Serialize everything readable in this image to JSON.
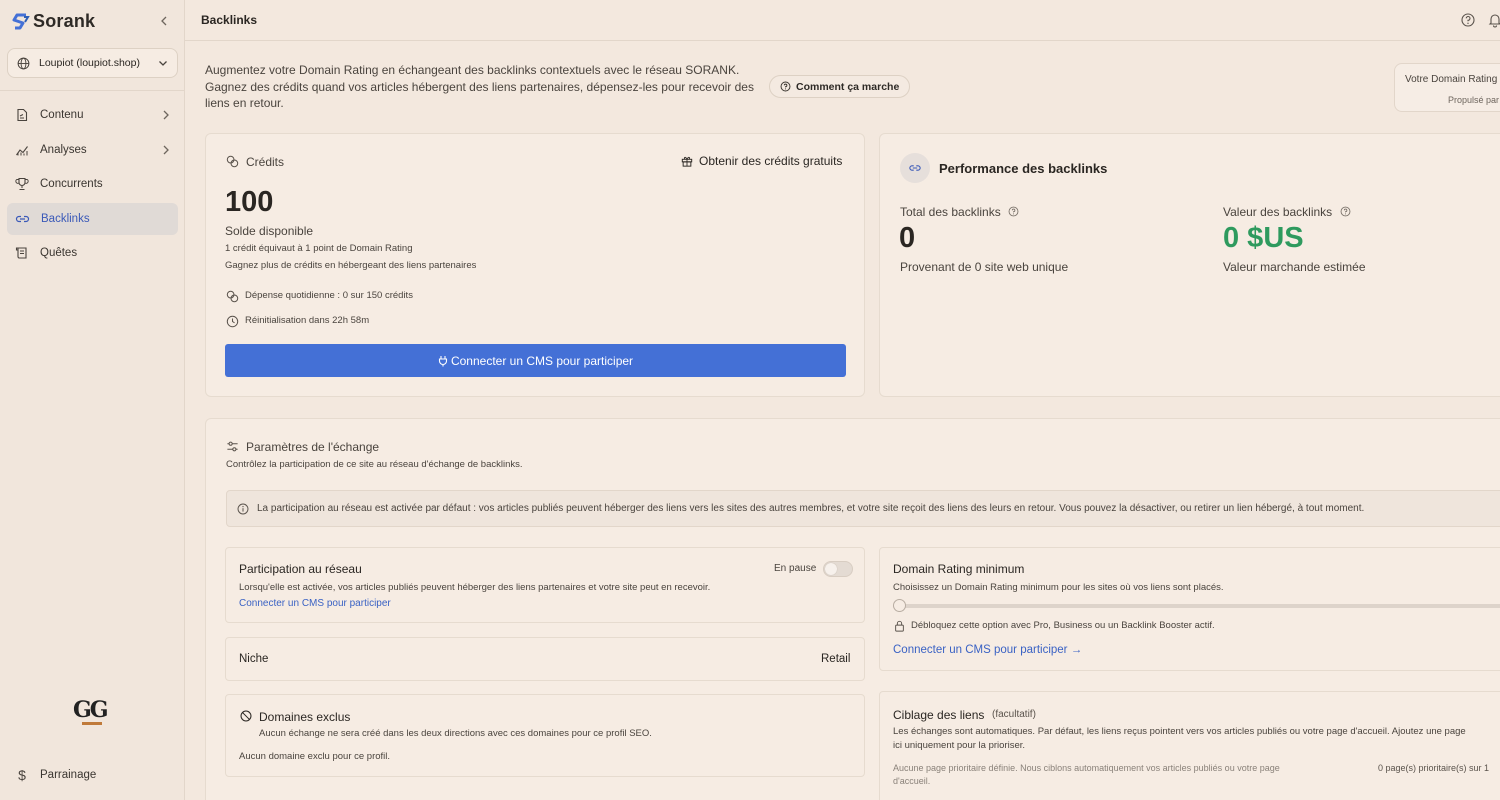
{
  "app": {
    "name": "Sorank"
  },
  "site_selector": {
    "label": "Loupiot (loupiot.shop)"
  },
  "nav": [
    {
      "label": "Contenu",
      "icon": "document-icon",
      "has_chevron": true
    },
    {
      "label": "Analyses",
      "icon": "chart-icon",
      "has_chevron": true
    },
    {
      "label": "Concurrents",
      "icon": "trophy-icon",
      "has_chevron": false
    },
    {
      "label": "Backlinks",
      "icon": "link-icon",
      "has_chevron": false,
      "active": true
    },
    {
      "label": "Quêtes",
      "icon": "scroll-icon",
      "has_chevron": false
    }
  ],
  "brand_logo": "GG",
  "referral": {
    "label": "Parrainage"
  },
  "header": {
    "title": "Backlinks"
  },
  "intro": {
    "text": "Augmentez votre Domain Rating en échangeant des backlinks contextuels avec le réseau SORANK. Gagnez des crédits quand vos articles hébergent des liens partenaires, dépensez-les pour recevoir des liens en retour.",
    "how_button": "Comment ça marche"
  },
  "dr_card": {
    "title": "Votre Domain Rating",
    "subtitle": "Propulsé par"
  },
  "credits": {
    "title": "Crédits",
    "free_credits_link": "Obtenir des crédits gratuits",
    "balance": "100",
    "balance_label": "Solde disponible",
    "note1": "1 crédit équivaut à 1 point de Domain Rating",
    "note2": "Gagnez plus de crédits en hébergeant des liens partenaires",
    "daily_spend": "Dépense quotidienne : 0 sur 150 crédits",
    "reset": "Réinitialisation dans 22h 58m",
    "cta": "Connecter un CMS pour participer"
  },
  "performance": {
    "title": "Performance des backlinks",
    "total_label": "Total des backlinks",
    "total_value": "0",
    "total_sub": "Provenant de 0 site web unique",
    "value_label": "Valeur des backlinks",
    "value_value": "0 $US",
    "value_sub": "Valeur marchande estimée"
  },
  "params": {
    "title": "Paramètres de l'échange",
    "subtitle": "Contrôlez la participation de ce site au réseau d'échange de backlinks.",
    "banner": "La participation au réseau est activée par défaut : vos articles publiés peuvent héberger des liens vers les sites des autres membres, et votre site reçoit des liens des leurs en retour. Vous pouvez la désactiver, ou retirer un lien hébergé, à tout moment.",
    "participation": {
      "title": "Participation au réseau",
      "status": "En pause",
      "desc": "Lorsqu'elle est activée, vos articles publiés peuvent héberger des liens partenaires et votre site peut en recevoir.",
      "link": "Connecter un CMS pour participer"
    },
    "niche": {
      "label": "Niche",
      "value": "Retail"
    },
    "excluded": {
      "title": "Domaines exclus",
      "desc": "Aucun échange ne sera créé dans les deux directions avec ces domaines pour ce profil SEO.",
      "empty": "Aucun domaine exclu pour ce profil."
    },
    "min_dr": {
      "title": "Domain Rating minimum",
      "desc": "Choisissez un Domain Rating minimum pour les sites où vos liens sont placés.",
      "slider_value": 0,
      "lock_note": "Débloquez cette option avec Pro, Business ou un Backlink Booster actif.",
      "link": "Connecter un CMS pour participer →"
    },
    "targeting": {
      "title": "Ciblage des liens",
      "optional": "(facultatif)",
      "desc1": "Les échanges sont automatiques. Par défaut, les liens reçus pointent vers vos articles publiés ou votre page d'accueil. Ajoutez une page",
      "desc2": "ici uniquement pour la prioriser.",
      "none1": "Aucune page prioritaire définie. Nous ciblons automatiquement vos articles publiés ou votre page",
      "none2": "d'accueil.",
      "count": "0 page(s) prioritaire(s) sur 1"
    }
  },
  "colors": {
    "accent": "#4470d6",
    "link": "#3a62c4",
    "success": "#2e9a5e",
    "background": "#f3e8de"
  }
}
